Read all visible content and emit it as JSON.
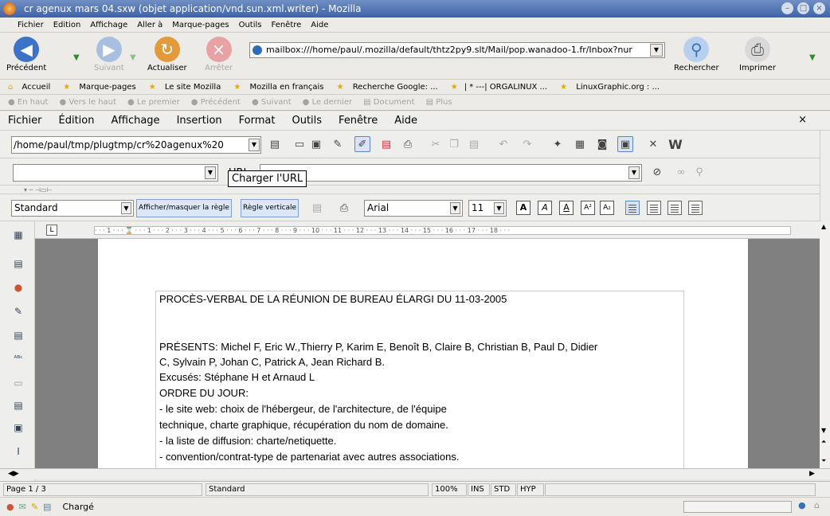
{
  "window": {
    "title": "cr agenux mars 04.sxw (objet application/vnd.sun.xml.writer) - Mozilla"
  },
  "mozilla_menu": [
    "Fichier",
    "Edition",
    "Affichage",
    "Aller à",
    "Marque-pages",
    "Outils",
    "Fenêtre",
    "Aide"
  ],
  "nav": {
    "back": "Précédent",
    "forward": "Suivant",
    "reload": "Actualiser",
    "stop": "Arrêter",
    "url": "mailbox:///home/paul/.mozilla/default/thtz2py9.slt/Mail/pop.wanadoo-1.fr/Inbox?nur",
    "search": "Rechercher",
    "print": "Imprimer"
  },
  "bookmarks": [
    "Accueil",
    "Marque-pages",
    "Le site Mozilla",
    "Mozilla en français",
    "Recherche Google: ...",
    "| * ---| ORGALINUX ...",
    "LinuxGraphic.org : ..."
  ],
  "doc_nav": [
    "En haut",
    "Vers le haut",
    "Le premier",
    "Précédent",
    "Suivant",
    "Le dernier",
    "Document",
    "Plus"
  ],
  "writer_menu": [
    "Fichier",
    "Édition",
    "Affichage",
    "Insertion",
    "Format",
    "Outils",
    "Fenêtre",
    "Aide"
  ],
  "function_bar": {
    "path": "/home/paul/tmp/plugtmp/cr%20agenux%20"
  },
  "url_bar": {
    "label": "URL",
    "tooltip": "Charger l'URL"
  },
  "format_bar": {
    "style": "Standard",
    "toggle_ruler": "Afficher/masquer la règle",
    "vertical_ruler": "Règle verticale",
    "font": "Arial",
    "size": "11"
  },
  "ruler_text": "· · · 1 · · · ⌛ · · · 1 · · · 2 · · · 3 · · · 4 · · · 5 · · · 6 · · · 7 · · · 8 · · · 9 · · · 10 · · · 11 · · · 12 · · · 13 · · · 14 · · · 15 · · · 16 · · · 17 · · · 18 · · ·",
  "document": {
    "title": "PROCÈS-VERBAL DE LA RÉUNION DE BUREAU ÉLARGI DU 11-03-2005",
    "lines": [
      "PRÉSENTS: Michel F, Eric W.,Thierry P, Karim E, Benoît B, Claire B, Christian B, Paul D, Didier",
      "C, Sylvain P, Johan C, Patrick A, Jean Richard B.",
      "Excusés: Stéphane H et Arnaud L",
      "ORDRE DU JOUR:",
      "- le site web: choix de l'hébergeur, de l'architecture, de l'équipe",
      "technique, charte graphique, récupération du nom de domaine.",
      "- la liste de diffusion: charte/netiquette.",
      "- convention/contrat-type de partenariat avec autres associations."
    ]
  },
  "status": {
    "page": "Page 1 / 3",
    "style": "Standard",
    "zoom": "100%",
    "ins": "INS",
    "std": "STD",
    "hyp": "HYP"
  },
  "bottom": {
    "status": "Chargé"
  }
}
